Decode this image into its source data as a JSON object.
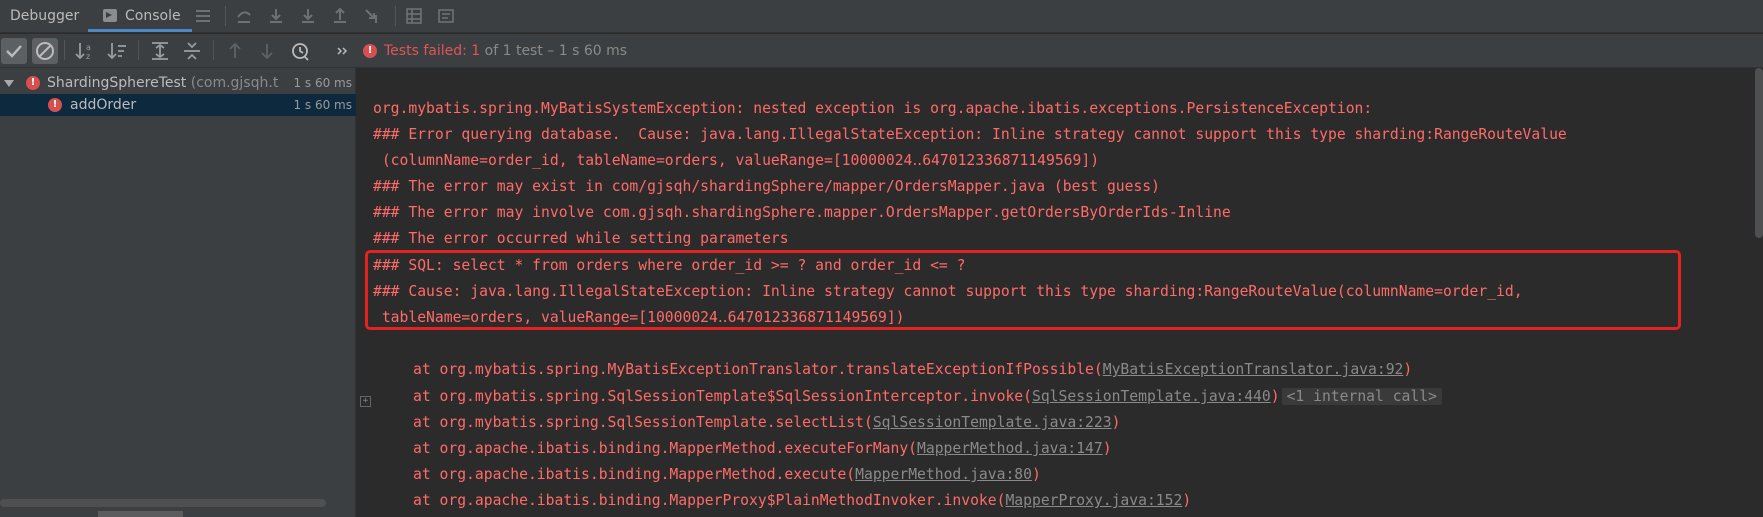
{
  "tabs": {
    "debugger": "Debugger",
    "console": "Console"
  },
  "toolbar_icons": [
    "menu-icon",
    "step-over-icon",
    "step-into-icon",
    "force-step-into-icon",
    "step-out-icon",
    "run-to-cursor-icon",
    "evaluate-icon",
    "trace-icon"
  ],
  "status": {
    "failed_label": "Tests failed: ",
    "count": "1",
    "rest": " of 1 test – 1 s 60 ms"
  },
  "tree": {
    "root": {
      "name": "ShardingSphereTest",
      "package": " (com.gjsqh.t",
      "time": "1 s 60 ms"
    },
    "child": {
      "name": "addOrder",
      "time": "1 s 60 ms"
    }
  },
  "console": {
    "lines": [
      "org.mybatis.spring.MyBatisSystemException: nested exception is org.apache.ibatis.exceptions.PersistenceException:",
      "### Error querying database.  Cause: java.lang.IllegalStateException: Inline strategy cannot support this type sharding:RangeRouteValue",
      " (columnName=order_id, tableName=orders, valueRange=[10000024‥647012336871149569])",
      "### The error may exist in com/gjsqh/shardingSphere/mapper/OrdersMapper.java (best guess)",
      "### The error may involve com.gjsqh.shardingSphere.mapper.OrdersMapper.getOrdersByOrderIds-Inline",
      "### The error occurred while setting parameters",
      "### SQL: select * from orders where order_id >= ? and order_id <= ?",
      "### Cause: java.lang.IllegalStateException: Inline strategy cannot support this type sharding:RangeRouteValue(columnName=order_id,",
      " tableName=orders, valueRange=[10000024‥647012336871149569])"
    ],
    "stack": [
      {
        "prefix": "at org.mybatis.spring.MyBatisExceptionTranslator.translateExceptionIfPossible(",
        "link": "MyBatisExceptionTranslator.java:92",
        "suffix": ")"
      },
      {
        "prefix": "at org.mybatis.spring.SqlSessionTemplate$SqlSessionInterceptor.invoke(",
        "link": "SqlSessionTemplate.java:440",
        "suffix": ")",
        "internal": "<1 internal call>"
      },
      {
        "prefix": "at org.mybatis.spring.SqlSessionTemplate.selectList(",
        "link": "SqlSessionTemplate.java:223",
        "suffix": ")"
      },
      {
        "prefix": "at org.apache.ibatis.binding.MapperMethod.executeForMany(",
        "link": "MapperMethod.java:147",
        "suffix": ")"
      },
      {
        "prefix": "at org.apache.ibatis.binding.MapperMethod.execute(",
        "link": "MapperMethod.java:80",
        "suffix": ")"
      },
      {
        "prefix": "at org.apache.ibatis.binding.MapperProxy$PlainMethodInvoker.invoke(",
        "link": "MapperProxy.java:152",
        "suffix": ")"
      }
    ]
  }
}
